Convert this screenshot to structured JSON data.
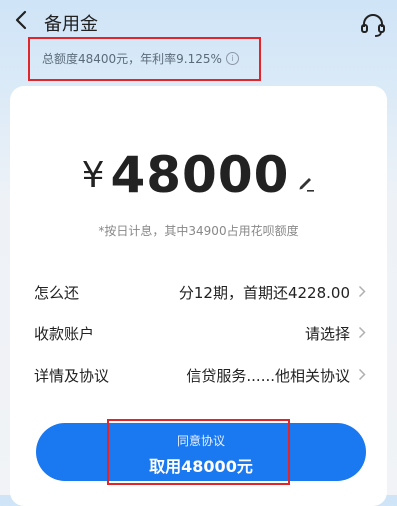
{
  "header": {
    "title": "备用金"
  },
  "limit": {
    "text": "总额度48400元，年利率9.125%",
    "info_glyph": "i"
  },
  "amount": {
    "currency": "¥",
    "value": "48000"
  },
  "note": "*按日计息，其中34900占用花呗额度",
  "rows": [
    {
      "label": "怎么还",
      "value": "分12期，首期还4228.00"
    },
    {
      "label": "收款账户",
      "value": "请选择"
    },
    {
      "label": "详情及协议",
      "value": "信贷服务......他相关协议"
    }
  ],
  "cta": {
    "sub": "同意协议",
    "main": "取用48000元"
  },
  "colors": {
    "accent": "#1a78f0",
    "highlight": "#e0252b"
  },
  "icons": [
    "back-icon",
    "headset-icon",
    "info-icon",
    "edit-icon",
    "chevron-right-icon"
  ]
}
